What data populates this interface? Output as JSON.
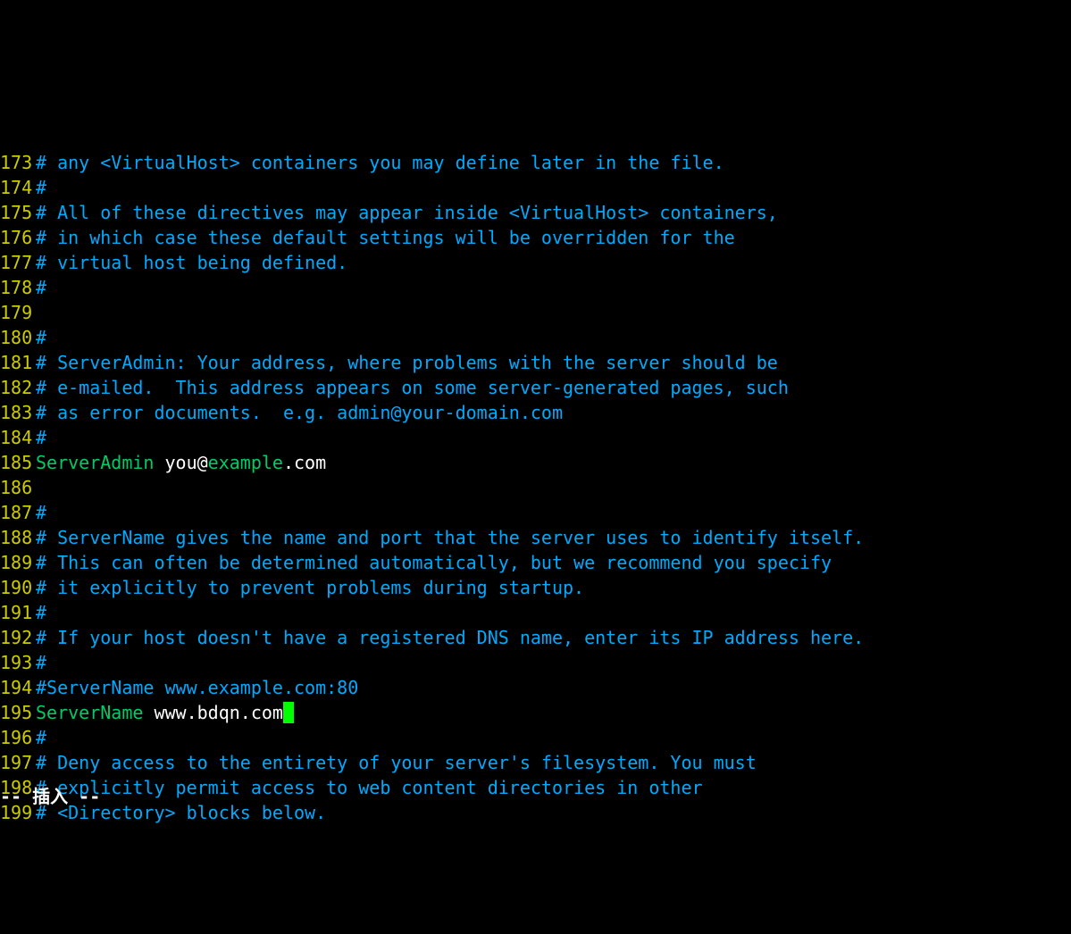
{
  "lines": [
    {
      "num": "173",
      "segments": [
        {
          "cls": "comment",
          "text": "# any <VirtualHost> containers you may define later in the file."
        }
      ]
    },
    {
      "num": "174",
      "segments": [
        {
          "cls": "comment",
          "text": "#"
        }
      ]
    },
    {
      "num": "175",
      "segments": [
        {
          "cls": "comment",
          "text": "# All of these directives may appear inside <VirtualHost> containers,"
        }
      ]
    },
    {
      "num": "176",
      "segments": [
        {
          "cls": "comment",
          "text": "# in which case these default settings will be overridden for the"
        }
      ]
    },
    {
      "num": "177",
      "segments": [
        {
          "cls": "comment",
          "text": "# virtual host being defined."
        }
      ]
    },
    {
      "num": "178",
      "segments": [
        {
          "cls": "comment",
          "text": "#"
        }
      ]
    },
    {
      "num": "179",
      "segments": []
    },
    {
      "num": "180",
      "segments": [
        {
          "cls": "comment",
          "text": "#"
        }
      ]
    },
    {
      "num": "181",
      "segments": [
        {
          "cls": "comment",
          "text": "# ServerAdmin: Your address, where problems with the server should be"
        }
      ]
    },
    {
      "num": "182",
      "segments": [
        {
          "cls": "comment",
          "text": "# e-mailed.  This address appears on some server-generated pages, such"
        }
      ]
    },
    {
      "num": "183",
      "segments": [
        {
          "cls": "comment",
          "text": "# as error documents.  e.g. admin@your-domain.com"
        }
      ]
    },
    {
      "num": "184",
      "segments": [
        {
          "cls": "comment",
          "text": "#"
        }
      ]
    },
    {
      "num": "185",
      "segments": [
        {
          "cls": "directive",
          "text": "ServerAdmin"
        },
        {
          "cls": "text",
          "text": " you@"
        },
        {
          "cls": "special",
          "text": "example"
        },
        {
          "cls": "text",
          "text": ".com"
        }
      ]
    },
    {
      "num": "186",
      "segments": []
    },
    {
      "num": "187",
      "segments": [
        {
          "cls": "comment",
          "text": "#"
        }
      ]
    },
    {
      "num": "188",
      "segments": [
        {
          "cls": "comment",
          "text": "# ServerName gives the name and port that the server uses to identify itself."
        }
      ]
    },
    {
      "num": "189",
      "segments": [
        {
          "cls": "comment",
          "text": "# This can often be determined automatically, but we recommend you specify"
        }
      ]
    },
    {
      "num": "190",
      "segments": [
        {
          "cls": "comment",
          "text": "# it explicitly to prevent problems during startup."
        }
      ]
    },
    {
      "num": "191",
      "segments": [
        {
          "cls": "comment",
          "text": "#"
        }
      ]
    },
    {
      "num": "192",
      "segments": [
        {
          "cls": "comment",
          "text": "# If your host doesn't have a registered DNS name, enter its IP address here."
        }
      ]
    },
    {
      "num": "193",
      "segments": [
        {
          "cls": "comment",
          "text": "#"
        }
      ]
    },
    {
      "num": "194",
      "segments": [
        {
          "cls": "comment",
          "text": "#ServerName www.example.com:80"
        }
      ]
    },
    {
      "num": "195",
      "segments": [
        {
          "cls": "directive",
          "text": "ServerName"
        },
        {
          "cls": "text",
          "text": " www.bdqn.com"
        }
      ],
      "cursor": true
    },
    {
      "num": "196",
      "segments": [
        {
          "cls": "comment",
          "text": "#"
        }
      ]
    },
    {
      "num": "197",
      "segments": [
        {
          "cls": "comment",
          "text": "# Deny access to the entirety of your server's filesystem. You must"
        }
      ]
    },
    {
      "num": "198",
      "segments": [
        {
          "cls": "comment",
          "text": "# explicitly permit access to web content directories in other"
        }
      ]
    },
    {
      "num": "199",
      "segments": [
        {
          "cls": "comment",
          "text": "# <Directory> blocks below."
        }
      ]
    }
  ],
  "status": "-- 插入 --"
}
